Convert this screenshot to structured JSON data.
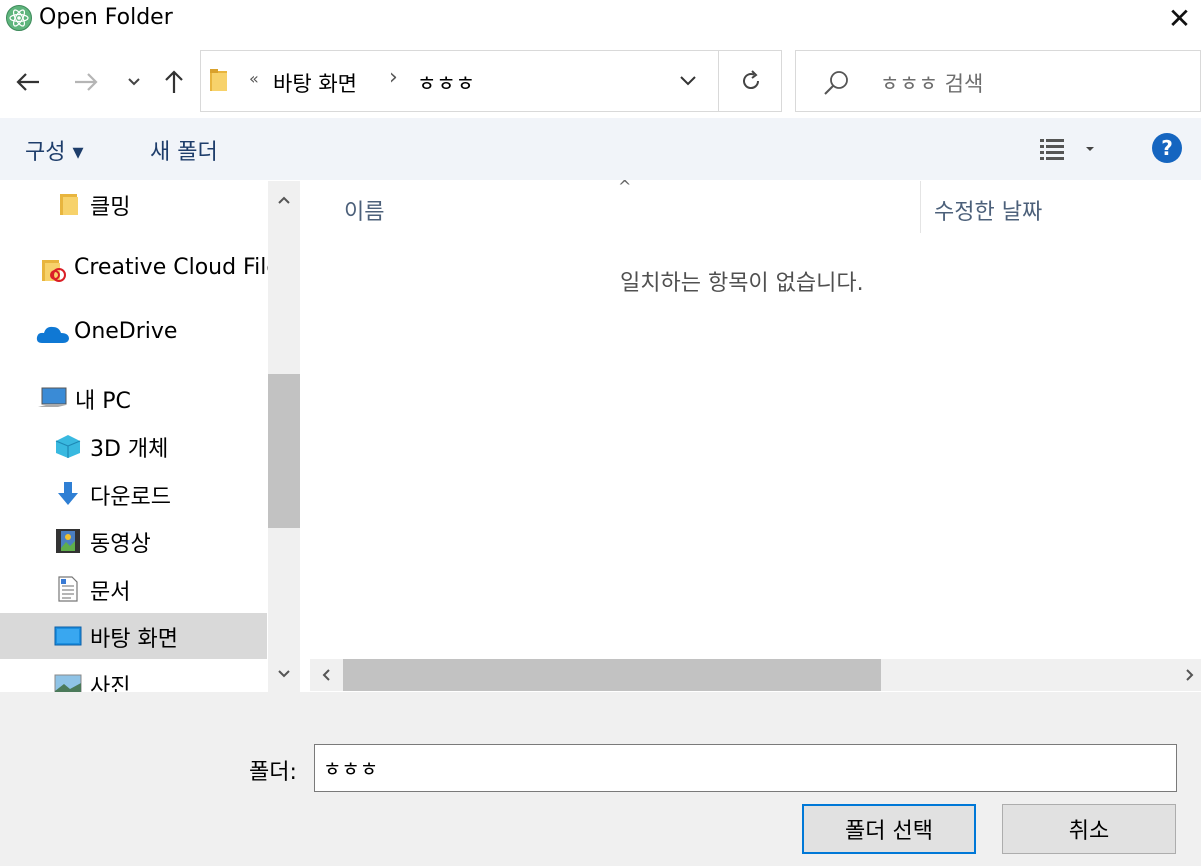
{
  "window": {
    "title": "Open Folder",
    "close_symbol": "✕"
  },
  "nav": {
    "back_icon": "arrow-left-icon",
    "forward_icon": "arrow-right-icon",
    "recent_icon": "chevron-down-icon",
    "up_icon": "arrow-up-icon"
  },
  "address": {
    "overflow": "«",
    "crumbs": [
      "바탕 화면",
      "ㅎㅎㅎ"
    ],
    "separator": "›"
  },
  "search": {
    "placeholder": "ㅎㅎㅎ 검색"
  },
  "toolbar": {
    "organize_label": "구성 ▾",
    "new_folder_label": "새 폴더",
    "help_label": "?"
  },
  "sidebar": {
    "items": [
      {
        "label": "클밍",
        "icon": "folder-icon"
      },
      {
        "label": "Creative Cloud Files",
        "icon": "creative-cloud-folder-icon"
      },
      {
        "label": "OneDrive",
        "icon": "onedrive-cloud-icon"
      },
      {
        "label": "내 PC",
        "icon": "computer-icon"
      },
      {
        "label": "3D 개체",
        "icon": "3d-objects-icon"
      },
      {
        "label": "다운로드",
        "icon": "download-arrow-icon"
      },
      {
        "label": "동영상",
        "icon": "video-icon"
      },
      {
        "label": "문서",
        "icon": "document-icon"
      },
      {
        "label": "바탕 화면",
        "icon": "desktop-icon",
        "selected": true
      },
      {
        "label": "사진",
        "icon": "pictures-icon"
      }
    ]
  },
  "content": {
    "columns": [
      "이름",
      "수정한 날짜"
    ],
    "sort_indicator": "^",
    "empty_message": "일치하는 항목이 없습니다."
  },
  "bottom": {
    "folder_label": "폴더:",
    "folder_value": "ㅎㅎㅎ",
    "select_button": "폴더 선택",
    "cancel_button": "취소"
  },
  "colors": {
    "accent": "#0078d7",
    "selected_bg": "#d9d9d9",
    "command_bar_bg": "#f1f4f9",
    "help_blue": "#1565c0"
  }
}
